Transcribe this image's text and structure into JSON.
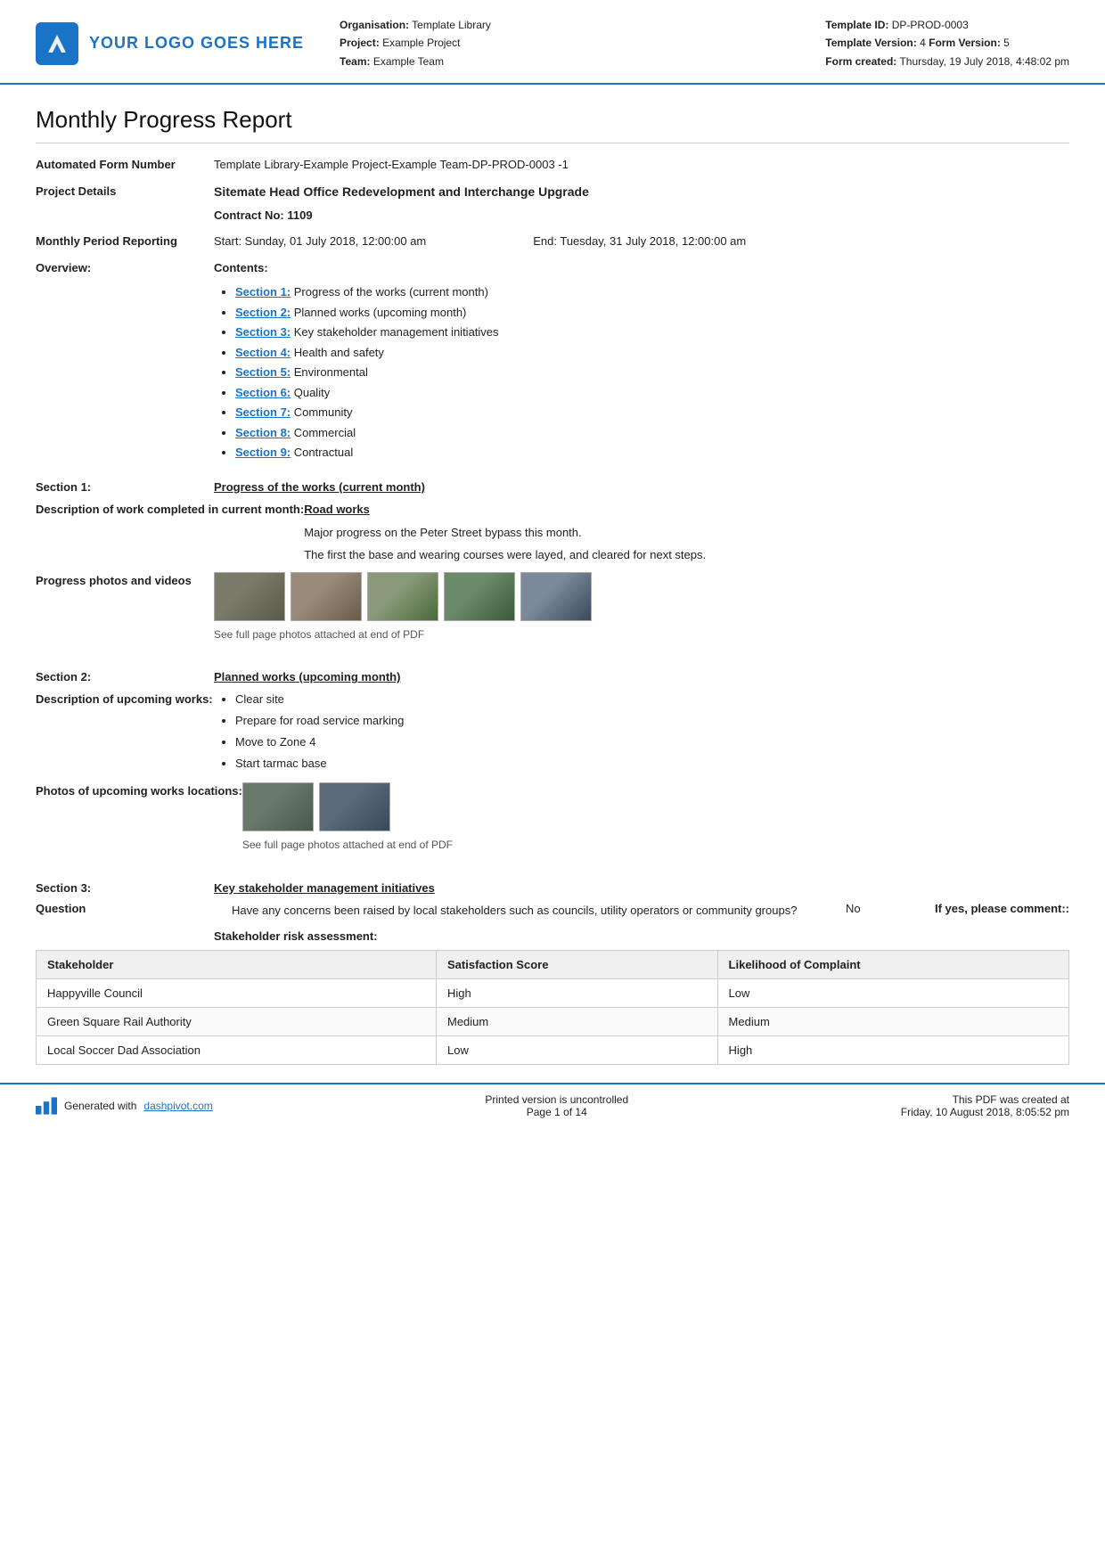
{
  "header": {
    "logo_text": "YOUR LOGO GOES HERE",
    "org_label": "Organisation:",
    "org_value": "Template Library",
    "project_label": "Project:",
    "project_value": "Example Project",
    "team_label": "Team:",
    "team_value": "Example Team",
    "template_id_label": "Template ID:",
    "template_id_value": "DP-PROD-0003",
    "template_version_label": "Template Version:",
    "template_version_value": "4",
    "form_version_label": "Form Version:",
    "form_version_value": "5",
    "form_created_label": "Form created:",
    "form_created_value": "Thursday, 19 July 2018, 4:48:02 pm"
  },
  "report": {
    "title": "Monthly Progress Report",
    "automated_form_label": "Automated Form Number",
    "automated_form_value": "Template Library-Example Project-Example Team-DP-PROD-0003   -1",
    "project_details_label": "Project Details",
    "project_details_value": "Sitemate Head Office Redevelopment and Interchange Upgrade",
    "contract_label": "Contract No:",
    "contract_value": "1109",
    "period_label": "Monthly Period Reporting",
    "period_start": "Start: Sunday, 01 July 2018, 12:00:00 am",
    "period_end": "End: Tuesday, 31 July 2018, 12:00:00 am",
    "overview_label": "Overview:",
    "overview_contents_label": "Contents:"
  },
  "contents": [
    {
      "id": "Section 1",
      "text": "Progress of the works (current month)"
    },
    {
      "id": "Section 2",
      "text": "Planned works (upcoming month)"
    },
    {
      "id": "Section 3",
      "text": "Key stakeholder management initiatives"
    },
    {
      "id": "Section 4",
      "text": "Health and safety"
    },
    {
      "id": "Section 5",
      "text": "Environmental"
    },
    {
      "id": "Section 6",
      "text": "Quality"
    },
    {
      "id": "Section 7",
      "text": "Community"
    },
    {
      "id": "Section 8",
      "text": "Commercial"
    },
    {
      "id": "Section 9",
      "text": "Contractual"
    }
  ],
  "section1": {
    "label": "Section 1:",
    "title": "Progress of the works (current month)",
    "desc_label": "Description of work completed in current month:",
    "work_type": "Road works",
    "desc_line1": "Major progress on the Peter Street bypass this month.",
    "desc_line2": "The first the base and wearing courses were layed, and cleared for next steps.",
    "photos_label": "Progress photos and videos",
    "photos_caption": "See full page photos attached at end of PDF"
  },
  "section2": {
    "label": "Section 2:",
    "title": "Planned works (upcoming month)",
    "desc_label": "Description of upcoming works:",
    "items": [
      "Clear site",
      "Prepare for road service marking",
      "Move to Zone 4",
      "Start tarmac base"
    ],
    "photos_label": "Photos of upcoming works locations:",
    "photos_caption": "See full page photos attached at end of PDF"
  },
  "section3": {
    "label": "Section 3:",
    "title": "Key stakeholder management initiatives",
    "question_label": "Question",
    "question_text": "Have any concerns been raised by local stakeholders such as councils, utility operators or community groups?",
    "question_answer": "No",
    "question_comment_label": "If yes, please comment::"
  },
  "stakeholder_table": {
    "section_label": "Stakeholder risk assessment:",
    "columns": [
      "Stakeholder",
      "Satisfaction Score",
      "Likelihood of Complaint"
    ],
    "rows": [
      [
        "Happyville Council",
        "High",
        "Low"
      ],
      [
        "Green Square Rail Authority",
        "Medium",
        "Medium"
      ],
      [
        "Local Soccer Dad Association",
        "Low",
        "High"
      ]
    ]
  },
  "footer": {
    "generated_text": "Generated with",
    "link_text": "dashpivot.com",
    "center_line1": "Printed version is uncontrolled",
    "center_line2": "Page 1 of 14",
    "right_line1": "This PDF was created at",
    "right_line2": "Friday, 10 August 2018, 8:05:52 pm"
  }
}
